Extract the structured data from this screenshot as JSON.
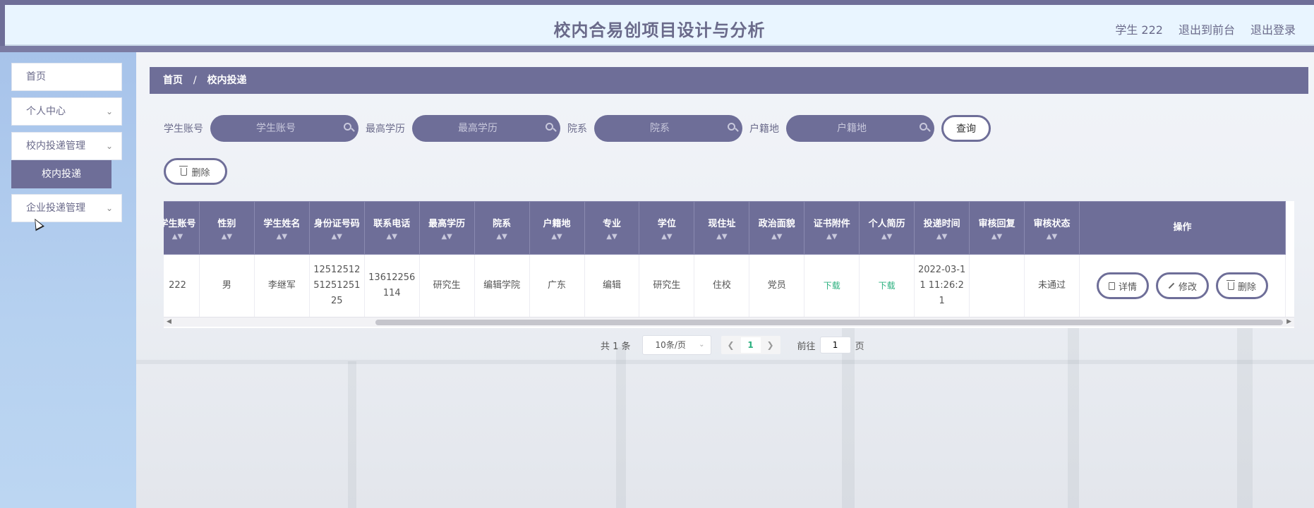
{
  "header": {
    "title": "校内合易创项目设计与分析",
    "user": "学生 222",
    "to_front": "退出到前台",
    "logout": "退出登录"
  },
  "sidebar": {
    "items": [
      {
        "label": "首页"
      },
      {
        "label": "个人中心"
      },
      {
        "label": "校内投递管理"
      },
      {
        "label": "企业投递管理"
      }
    ],
    "sub_active": "校内投递"
  },
  "breadcrumb": {
    "home": "首页",
    "sep": "/",
    "current": "校内投递"
  },
  "search": {
    "fields": [
      {
        "label": "学生账号",
        "placeholder": "学生账号"
      },
      {
        "label": "最高学历",
        "placeholder": "最高学历"
      },
      {
        "label": "院系",
        "placeholder": "院系"
      },
      {
        "label": "户籍地",
        "placeholder": "户籍地"
      }
    ],
    "query_label": "查询"
  },
  "toolbar": {
    "delete_label": "删除"
  },
  "table": {
    "columns": [
      "学生账号",
      "性别",
      "学生姓名",
      "身份证号码",
      "联系电话",
      "最高学历",
      "院系",
      "户籍地",
      "专业",
      "学位",
      "现住址",
      "政治面貌",
      "证书附件",
      "个人简历",
      "投递时间",
      "审核回复",
      "审核状态",
      "操作"
    ],
    "row": {
      "account": "222",
      "gender": "男",
      "name": "李继军",
      "id_number": "125125125125125125",
      "phone": "13612256114",
      "education": "研究生",
      "department": "编辑学院",
      "hometown": "广东",
      "major": "编辑",
      "degree": "研究生",
      "address": "住校",
      "political": "党员",
      "certificate": "下载",
      "resume": "下载",
      "time": "2022-03-11 11:26:21",
      "reply": "",
      "status": "未通过"
    },
    "actions": {
      "detail": "详情",
      "edit": "修改",
      "delete": "删除"
    }
  },
  "pagination": {
    "total": "共 1 条",
    "page_size": "10条/页",
    "current": "1",
    "goto_prefix": "前往",
    "goto_value": "1",
    "goto_suffix": "页"
  },
  "colors": {
    "primary": "#6e6e98",
    "header_bg": "#e9f5ff",
    "sidebar_bg": "#b6d1f0",
    "download": "#2bb07f"
  }
}
